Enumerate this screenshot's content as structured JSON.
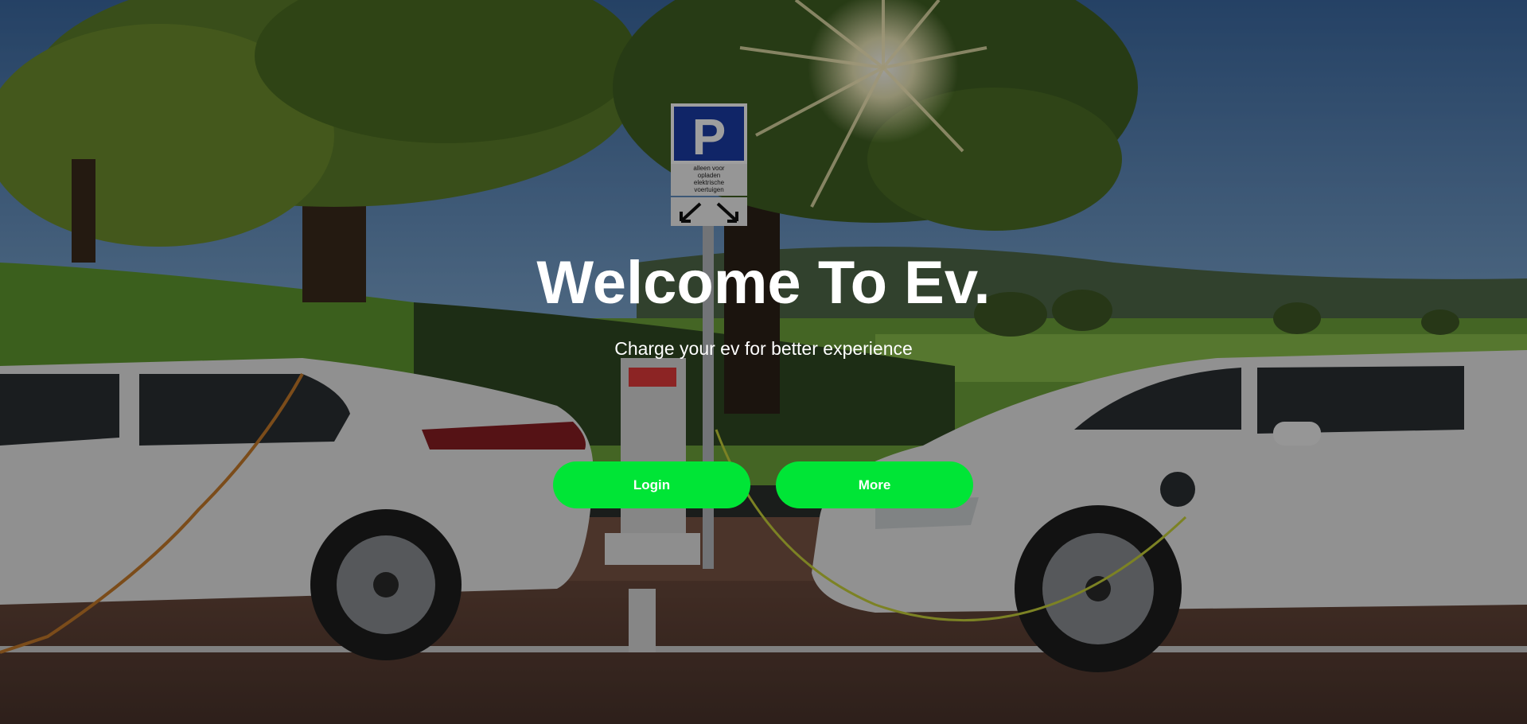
{
  "hero": {
    "title": "Welcome To Ev.",
    "subtitle": "Charge your ev for better experience",
    "sign": {
      "letter": "P",
      "caption_lines": [
        "alleen voor",
        "opladen",
        "elektrische",
        "voertuigen"
      ]
    }
  },
  "actions": {
    "login_label": "Login",
    "more_label": "More"
  },
  "colors": {
    "button": "#00e536",
    "text": "#ffffff",
    "sign_blue": "#1a3da6"
  }
}
